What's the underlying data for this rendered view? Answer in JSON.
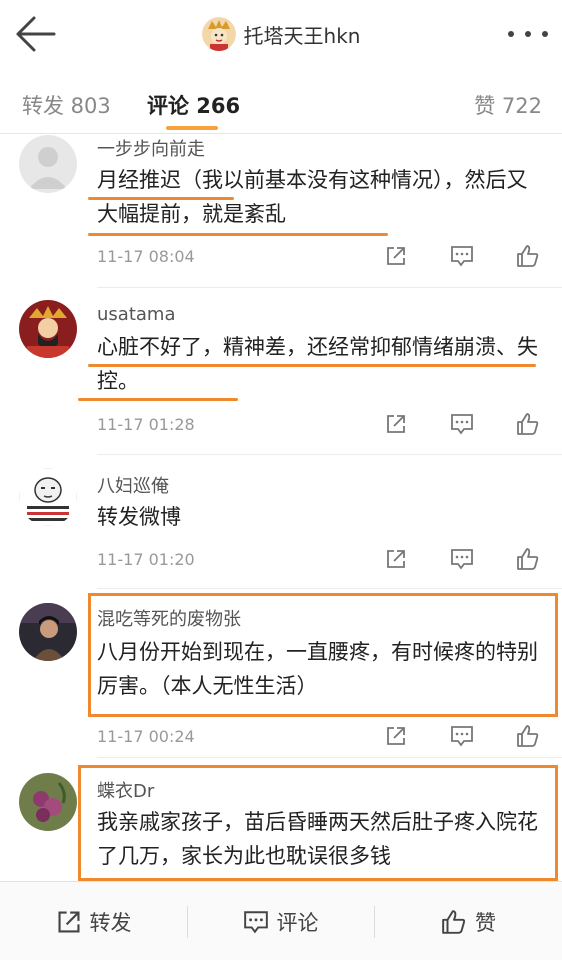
{
  "header": {
    "title": "托塔天王hkn"
  },
  "tabs": {
    "repost": "转发 803",
    "comment": "评论 266",
    "like": "赞 722"
  },
  "comments": [
    {
      "name": "一步步向前走",
      "text": "月经推迟（我以前基本没有这种情况），然后又大幅提前，就是紊乱",
      "time": "11-17 08:04"
    },
    {
      "name": "usatama",
      "text": "心脏不好了，精神差，还经常抑郁情绪崩溃、失控。",
      "time": "11-17 01:28"
    },
    {
      "name": "八妇巡俺",
      "text": "转发微博",
      "time": "11-17 01:20"
    },
    {
      "name": "混吃等死的废物张",
      "text": "八月份开始到现在，一直腰疼，有时候疼的特别厉害。（本人无性生活）",
      "time": "11-17 00:24"
    },
    {
      "name": "蝶衣Dr",
      "text": "我亲戚家孩子，苗后昏睡两天然后肚子疼入院花了几万，家长为此也耽误很多钱",
      "time": ""
    }
  ],
  "bottom_bar": {
    "repost": "转发",
    "comment": "评论",
    "like": "赞"
  },
  "colors": {
    "highlight": "#f0892e",
    "tab_underline": "#f7a23a"
  },
  "icons": [
    "back-arrow-icon",
    "more-icon",
    "share-icon",
    "comment-icon",
    "like-icon"
  ]
}
